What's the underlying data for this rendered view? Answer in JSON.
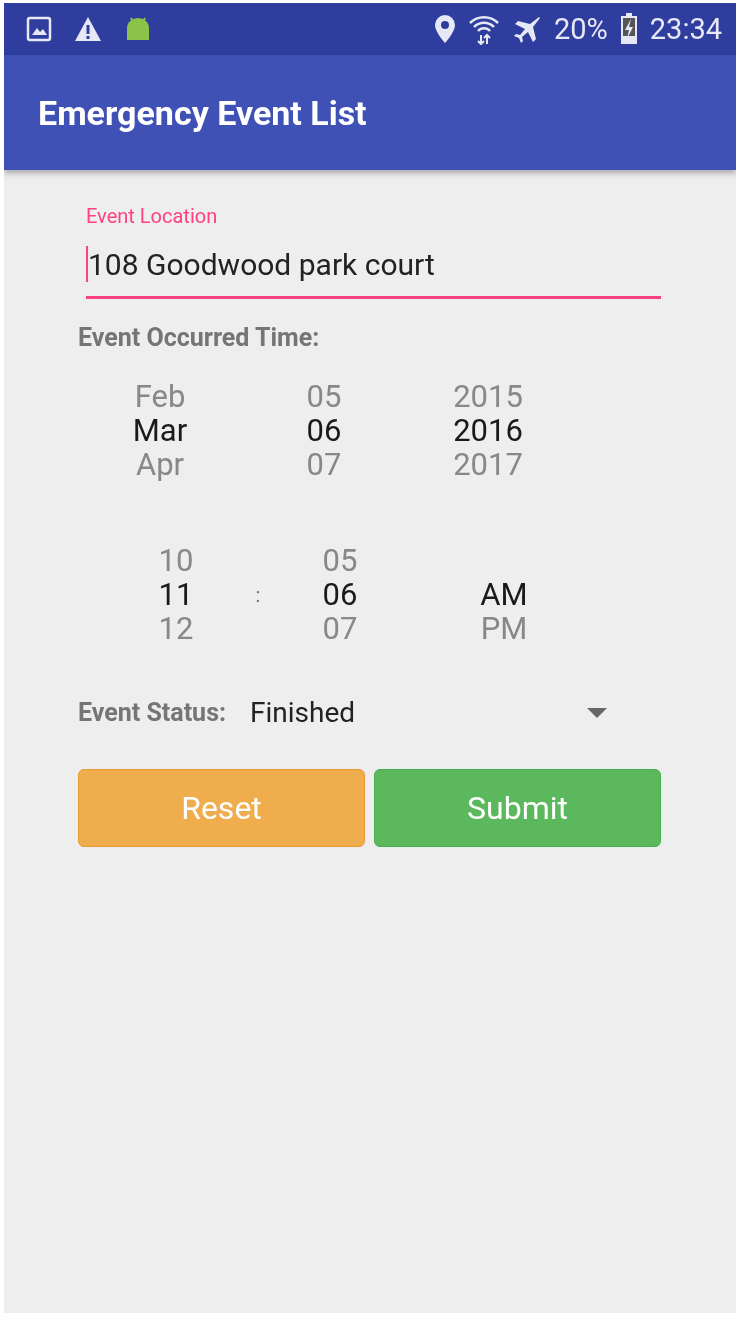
{
  "status_bar": {
    "battery": "20%",
    "time": "23:34"
  },
  "app_bar": {
    "title": "Emergency Event List"
  },
  "location_field": {
    "label": "Event Location",
    "value": "108 Goodwood park court"
  },
  "time_section": {
    "label": "Event Occurred Time:"
  },
  "date_picker": {
    "columns": [
      {
        "items": [
          {
            "text": "Feb",
            "selected": false
          },
          {
            "text": "Mar",
            "selected": true
          },
          {
            "text": "Apr",
            "selected": false
          }
        ]
      },
      {
        "items": [
          {
            "text": "05",
            "selected": false
          },
          {
            "text": "06",
            "selected": true
          },
          {
            "text": "07",
            "selected": false
          }
        ]
      },
      {
        "items": [
          {
            "text": "2015",
            "selected": false
          },
          {
            "text": "2016",
            "selected": true
          },
          {
            "text": "2017",
            "selected": false
          }
        ]
      }
    ]
  },
  "time_picker": {
    "separator": ":",
    "columns": [
      {
        "items": [
          {
            "text": "10",
            "selected": false
          },
          {
            "text": "11",
            "selected": true
          },
          {
            "text": "12",
            "selected": false
          }
        ]
      },
      {
        "items": [
          {
            "text": "05",
            "selected": false
          },
          {
            "text": "06",
            "selected": true
          },
          {
            "text": "07",
            "selected": false
          }
        ]
      },
      {
        "items": [
          {
            "text": "AM",
            "selected": true
          },
          {
            "text": "PM",
            "selected": false
          }
        ]
      }
    ]
  },
  "status_field": {
    "label": "Event Status:",
    "value": "Finished"
  },
  "buttons": [
    {
      "label": "Reset",
      "kind": "warning"
    },
    {
      "label": "Submit",
      "kind": "success"
    }
  ]
}
